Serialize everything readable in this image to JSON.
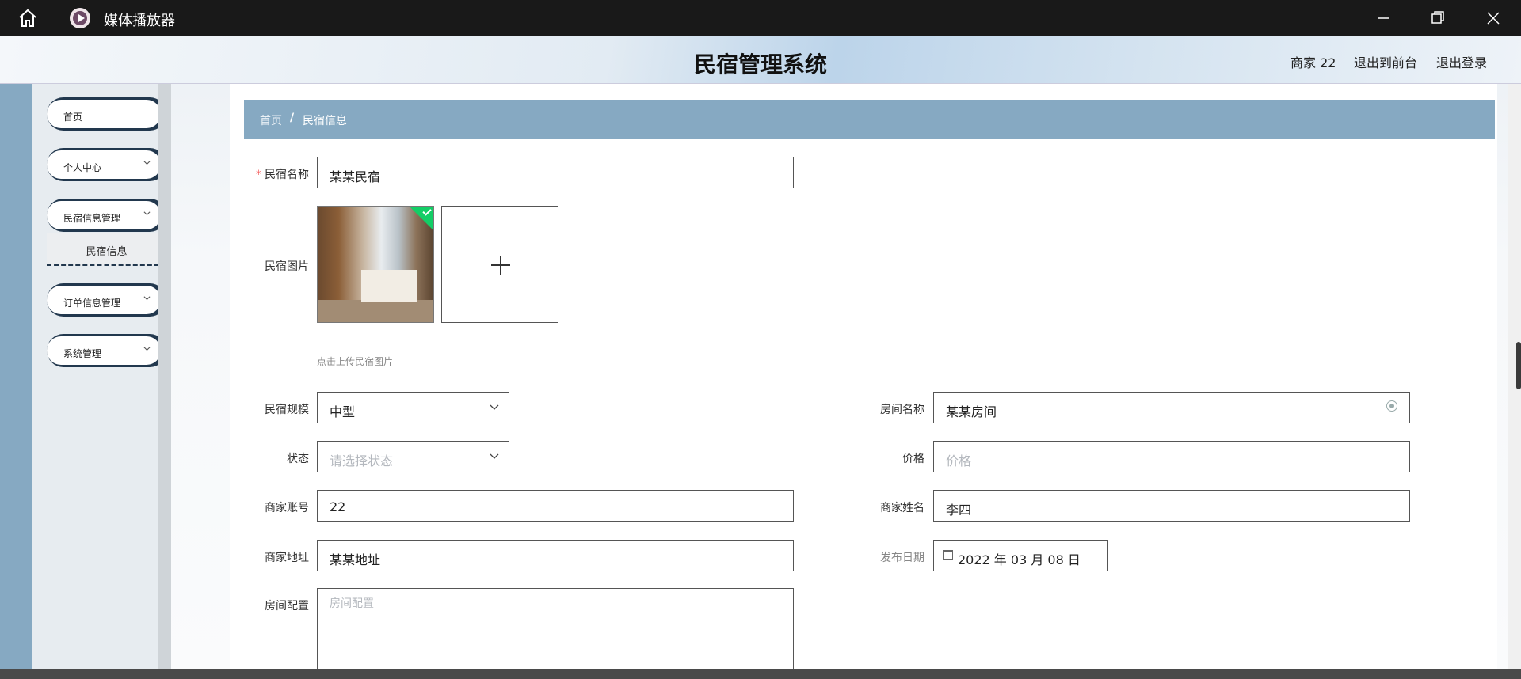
{
  "window": {
    "title": "媒体播放器"
  },
  "header": {
    "title": "民宿管理系统",
    "user": "商家 22",
    "front": "退出到前台",
    "logout": "退出登录"
  },
  "sidebar": {
    "items": [
      {
        "label": "首页"
      },
      {
        "label": "个人中心"
      },
      {
        "label": "民宿信息管理"
      },
      {
        "label": "订单信息管理"
      },
      {
        "label": "系统管理"
      }
    ],
    "submenu": {
      "label": "民宿信息"
    }
  },
  "breadcrumb": {
    "home": "首页",
    "sep": "/",
    "current": "民宿信息"
  },
  "form": {
    "name": {
      "label": "民宿名称",
      "required": "*",
      "value": "某某民宿"
    },
    "image": {
      "label": "民宿图片",
      "hint": "点击上传民宿图片"
    },
    "scale": {
      "label": "民宿规模",
      "value": "中型"
    },
    "room_name": {
      "label": "房间名称",
      "value": "某某房间"
    },
    "status": {
      "label": "状态",
      "placeholder": "请选择状态"
    },
    "price": {
      "label": "价格",
      "placeholder": "价格"
    },
    "merchant_account": {
      "label": "商家账号",
      "value": "22"
    },
    "merchant_name": {
      "label": "商家姓名",
      "value": "李四"
    },
    "merchant_address": {
      "label": "商家地址",
      "value": "某某地址"
    },
    "publish_date": {
      "label": "发布日期",
      "value": "2022 年 03 月 08 日"
    },
    "room_config": {
      "label": "房间配置",
      "placeholder": "房间配置"
    }
  },
  "colors": {
    "sidebar_accent": "#22384e",
    "breadcrumb_bg": "#86a9c2",
    "success": "#13ce66"
  }
}
